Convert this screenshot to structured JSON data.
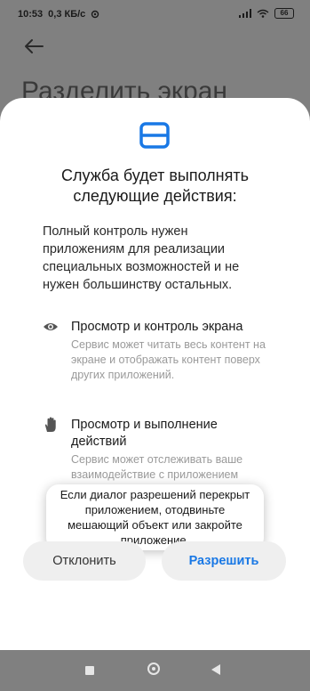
{
  "status_bar": {
    "time": "10:53",
    "speed": "0,3 КБ/с",
    "battery": "66"
  },
  "background": {
    "title": "Разделить экран"
  },
  "dialog": {
    "title": "Служба будет выполнять следующие действия:",
    "description": "Полный контроль нужен приложениям для реализации специальных возможностей и не нужен большинству остальных.",
    "permissions": [
      {
        "icon": "eye-icon",
        "title": "Просмотр и контроль экрана",
        "description": "Сервис может читать весь контент на экране и отображать контент поверх других приложений."
      },
      {
        "icon": "hand-icon",
        "title": "Просмотр и выполнение действий",
        "description": "Сервис может отслеживать ваше взаимодействие с приложением"
      }
    ],
    "toast": "Если диалог разрешений перекрыт приложением, отодвиньте мешающий объект или закройте приложение.",
    "buttons": {
      "deny": "Отклонить",
      "allow": "Разрешить"
    }
  },
  "colors": {
    "accent": "#1978e5",
    "scrim": "#808080",
    "sheet": "#ffffff",
    "button_bg": "#efefef"
  }
}
